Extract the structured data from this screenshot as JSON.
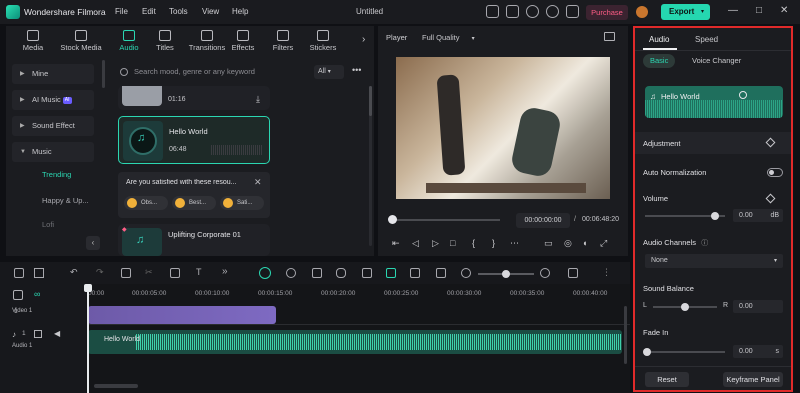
{
  "app": {
    "name": "Wondershare Filmora",
    "document_title": "Untitled",
    "menu": [
      "File",
      "Edit",
      "Tools",
      "View",
      "Help"
    ],
    "purchase_label": "Purchase",
    "export_label": "Export"
  },
  "media_tabs": [
    {
      "label": "Media",
      "icon": "media-icon"
    },
    {
      "label": "Stock Media",
      "icon": "stock-media-icon"
    },
    {
      "label": "Audio",
      "icon": "music-note-icon",
      "active": true
    },
    {
      "label": "Titles",
      "icon": "titles-icon"
    },
    {
      "label": "Transitions",
      "icon": "transitions-icon"
    },
    {
      "label": "Effects",
      "icon": "effects-icon"
    },
    {
      "label": "Filters",
      "icon": "filters-icon"
    },
    {
      "label": "Stickers",
      "icon": "stickers-icon"
    }
  ],
  "sidebar": {
    "items": [
      "Mine",
      "AI Music",
      "Sound Effect",
      "Music"
    ],
    "ai_badge": "AI",
    "music_sub": [
      "Trending",
      "Happy & Up...",
      "Lofi"
    ]
  },
  "library": {
    "search_placeholder": "Search mood, genre or any keyword",
    "filter": "All",
    "cards": [
      {
        "title": "",
        "duration": "01:16"
      },
      {
        "title": "Hello World",
        "duration": "06:48"
      },
      {
        "title": "Uplifting Corporate 01",
        "duration": ""
      }
    ],
    "survey": {
      "question": "Are you satisfied with these resou...",
      "options": [
        "Obs...",
        "Best...",
        "Sati..."
      ]
    }
  },
  "player": {
    "label": "Player",
    "quality": "Full Quality",
    "current_time": "00:00:00:00",
    "separator": "/",
    "total_time": "00:06:48:20",
    "progress": 0.0
  },
  "right_panel": {
    "tabs": [
      "Audio",
      "Speed"
    ],
    "subtabs": [
      "Basic",
      "Voice Changer"
    ],
    "clip_name": "Hello World",
    "adjustment_label": "Adjustment",
    "auto_normalization_label": "Auto Normalization",
    "volume_label": "Volume",
    "volume_value": "0.00",
    "volume_unit": "dB",
    "audio_channels_label": "Audio Channels",
    "audio_channels_value": "None",
    "sound_balance_label": "Sound Balance",
    "balance_left": "L",
    "balance_right": "R",
    "balance_value": "0.00",
    "fade_in_label": "Fade In",
    "fade_in_value": "0.00",
    "fade_in_unit": "s",
    "reset_label": "Reset",
    "keyframe_label": "Keyframe Panel",
    "highlight_color": "#e02a2a"
  },
  "timeline": {
    "ruler": [
      "00:00",
      "00:00:05:00",
      "00:00:10:00",
      "00:00:15:00",
      "00:00:20:00",
      "00:00:25:00",
      "00:00:30:00",
      "00:00:35:00",
      "00:00:40:00"
    ],
    "video_track_label": "Video 1",
    "audio_track_label": "Audio 1",
    "audio_clip_name": "Hello World",
    "track_numbers": [
      "1",
      "1"
    ]
  },
  "colors": {
    "accent": "#2bd6b1",
    "export": "#25d7b0",
    "purchase": "#ff5d86",
    "video_clip": "#7565b8",
    "audio_clip": "#1b4d43"
  }
}
